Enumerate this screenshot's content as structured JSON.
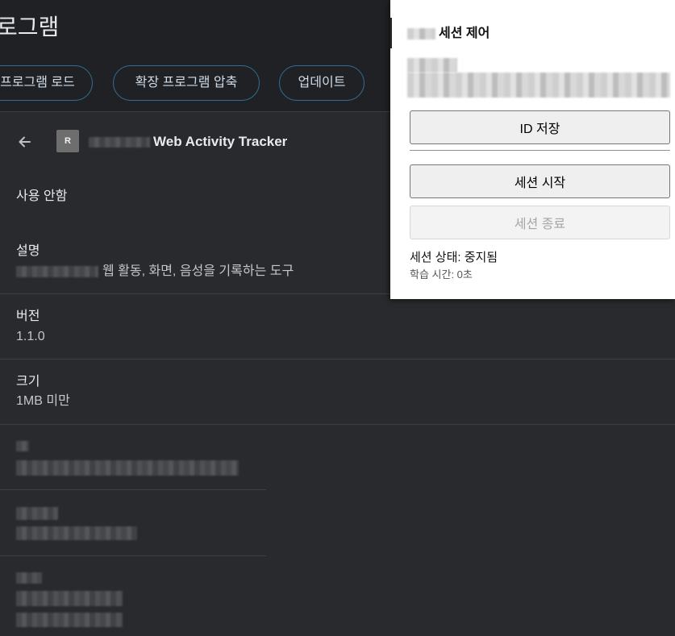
{
  "page": {
    "title": "로그램"
  },
  "toolbar": {
    "load_unpacked_label": "프로그램 로드",
    "pack_label": "확장 프로그램 압축",
    "update_label": "업데이트"
  },
  "extension": {
    "icon_letter": "R",
    "name": "Web Activity Tracker",
    "status": "사용 안함",
    "description_label": "설명",
    "description_value": "웹 활동, 화면, 음성을 기록하는 도구",
    "version_label": "버전",
    "version_value": "1.1.0",
    "size_label": "크기",
    "size_value": "1MB 미만"
  },
  "popup": {
    "title": "세션 제어",
    "save_id_label": "ID 저장",
    "start_label": "세션 시작",
    "end_label": "세션 종료",
    "status_text": "세션 상태: 중지됨",
    "time_text": "학습 시간: 0초"
  },
  "icons": {
    "back": "back-arrow-icon"
  },
  "colors": {
    "page_bg": "#202124",
    "card_bg": "#292a2d",
    "divider": "#3c4043",
    "text_primary": "#e8eaed",
    "pill_border": "#2f6f96",
    "popup_bg": "#ffffff"
  }
}
